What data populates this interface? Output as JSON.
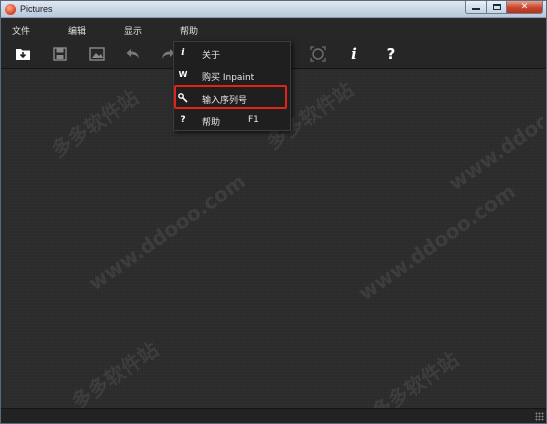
{
  "window": {
    "title": "Pictures"
  },
  "menubar": {
    "items": [
      {
        "label": "文件"
      },
      {
        "label": "编辑"
      },
      {
        "label": "显示"
      },
      {
        "label": "帮助"
      }
    ]
  },
  "toolbar": {
    "buttons": [
      {
        "icon": "open-folder-icon"
      },
      {
        "icon": "save-icon"
      },
      {
        "icon": "image-icon"
      },
      {
        "icon": "undo-icon"
      },
      {
        "icon": "redo-icon"
      },
      {
        "icon": "zoom-fit-icon"
      },
      {
        "icon": "info-icon",
        "glyph": "i"
      },
      {
        "icon": "help-icon",
        "glyph": "?"
      }
    ]
  },
  "help_menu": {
    "items": [
      {
        "icon": "info-icon",
        "glyph": "i",
        "label": "关于"
      },
      {
        "icon": "cart-icon",
        "glyph": "W",
        "label": "购买 Inpaint"
      },
      {
        "icon": "key-icon",
        "glyph": "🔧",
        "label": "输入序列号"
      },
      {
        "icon": "help-icon",
        "glyph": "?",
        "label": "帮助",
        "shortcut": "F1"
      }
    ]
  },
  "colors": {
    "highlight": "#e0241a",
    "background": "#2b2b2b"
  }
}
